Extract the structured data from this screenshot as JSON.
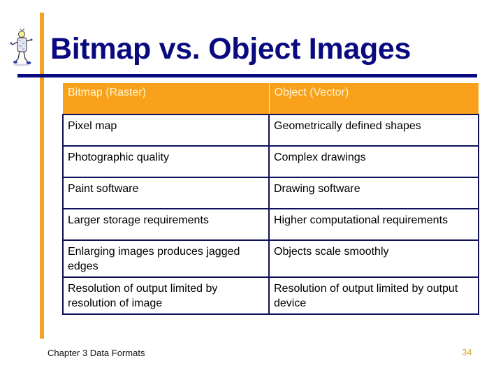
{
  "slide": {
    "title": "Bitmap vs. Object Images",
    "logo_icon": "walking-robot-clipart-icon",
    "colors": {
      "accent_orange": "#f9a11b",
      "title_navy": "#0a0a80",
      "page_number": "#d4a83a"
    }
  },
  "table": {
    "headers": [
      "Bitmap (Raster)",
      "Object (Vector)"
    ],
    "rows": [
      [
        "Pixel map",
        "Geometrically defined shapes"
      ],
      [
        "Photographic quality",
        "Complex drawings"
      ],
      [
        "Paint software",
        "Drawing software"
      ],
      [
        "Larger storage requirements",
        "Higher computational requirements"
      ],
      [
        "Enlarging images produces jagged edges",
        "Objects scale smoothly"
      ],
      [
        "Resolution of output limited by resolution of image",
        "Resolution of output limited by output device"
      ]
    ]
  },
  "footer": {
    "chapter": "Chapter 3 Data Formats",
    "page_number": "34"
  }
}
